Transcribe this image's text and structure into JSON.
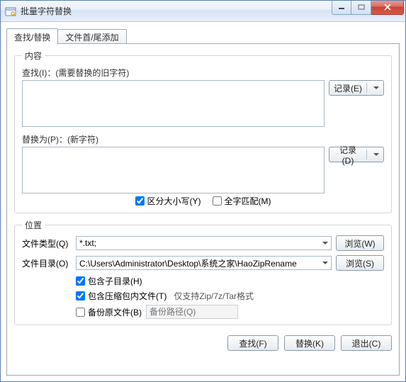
{
  "window": {
    "title": "批量字符替换"
  },
  "tabs": {
    "find_replace": "查找/替换",
    "head_tail_append": "文件首/尾添加"
  },
  "content_group": {
    "legend": "内容",
    "find_label": "查找(I)：(需要替换的旧字符)",
    "find_value": "",
    "record_e_label": "记录(E)",
    "replace_label": "替换为(P)：(新字符)",
    "replace_value": "",
    "record_d_label": "记录(D)",
    "case_sensitive_label": "区分大小写(Y)",
    "case_sensitive_checked": true,
    "whole_word_label": "全字匹配(M)",
    "whole_word_checked": false
  },
  "location_group": {
    "legend": "位置",
    "file_type_label": "文件类型(Q)",
    "file_type_value": "*.txt;",
    "browse_w_label": "浏览(W)",
    "file_dir_label": "文件目录(O)",
    "file_dir_value": "C:\\Users\\Administrator\\Desktop\\系统之家\\HaoZipRename",
    "browse_s_label": "浏览(S)",
    "include_subdir_label": "包含子目录(H)",
    "include_subdir_checked": true,
    "include_archive_label": "包含压缩包内文件(T)",
    "include_archive_hint": "仅支持Zip/7z/Tar格式",
    "include_archive_checked": true,
    "backup_original_label": "备份原文件(B)",
    "backup_original_checked": false,
    "backup_path_placeholder": "备份路径(Q)"
  },
  "footer": {
    "find_button": "查找(F)",
    "replace_button": "替换(K)",
    "exit_button": "退出(C)"
  }
}
